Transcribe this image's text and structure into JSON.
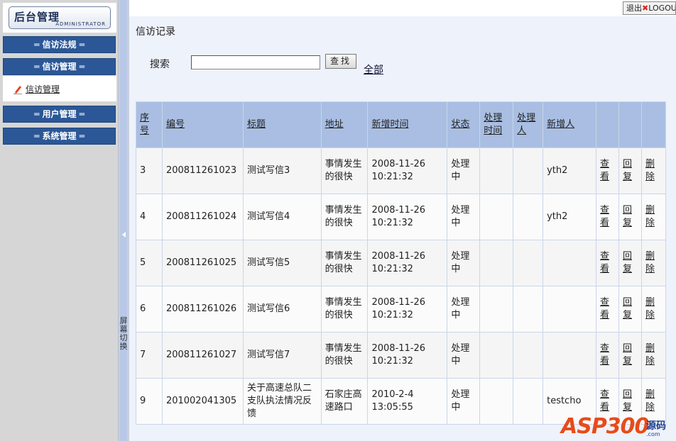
{
  "logo": {
    "title": "后台管理",
    "subtitle": "ADMINISTRATOR"
  },
  "nav": {
    "bars": "═",
    "groups": [
      "信访法规",
      "信访管理",
      "用户管理",
      "系统管理"
    ],
    "sub_item": "信访管理"
  },
  "splitter": {
    "label": "屏幕切换"
  },
  "topbar": {
    "logout_cn": "退出",
    "logout_en": "LOGOUT"
  },
  "page": {
    "title": "信访记录",
    "search_label": "搜索",
    "search_value": "",
    "search_button": "查找",
    "all_link": "全部"
  },
  "table": {
    "headers": [
      "序号",
      "编号",
      "标题",
      "地址",
      "新增时间",
      "状态",
      "处理时间",
      "处理人",
      "新增人",
      "",
      "",
      ""
    ],
    "actions": {
      "view": "查看",
      "reply": "回复",
      "delete": "删除"
    },
    "rows": [
      {
        "seq": "3",
        "code": "200811261023",
        "title": "测试写信3",
        "address": "事情发生的很快",
        "time": "2008-11-26 10:21:32",
        "status": "处理中",
        "handle_time": "",
        "handler": "",
        "creator": "yth2"
      },
      {
        "seq": "4",
        "code": "200811261024",
        "title": "测试写信4",
        "address": "事情发生的很快",
        "time": "2008-11-26 10:21:32",
        "status": "处理中",
        "handle_time": "",
        "handler": "",
        "creator": "yth2"
      },
      {
        "seq": "5",
        "code": "200811261025",
        "title": "测试写信5",
        "address": "事情发生的很快",
        "time": "2008-11-26 10:21:32",
        "status": "处理中",
        "handle_time": "",
        "handler": "",
        "creator": ""
      },
      {
        "seq": "6",
        "code": "200811261026",
        "title": "测试写信6",
        "address": "事情发生的很快",
        "time": "2008-11-26 10:21:32",
        "status": "处理中",
        "handle_time": "",
        "handler": "",
        "creator": ""
      },
      {
        "seq": "7",
        "code": "200811261027",
        "title": "测试写信7",
        "address": "事情发生的很快",
        "time": "2008-11-26 10:21:32",
        "status": "处理中",
        "handle_time": "",
        "handler": "",
        "creator": ""
      },
      {
        "seq": "9",
        "code": "201002041305",
        "title": "关于高速总队二支队执法情况反馈",
        "address": "石家庄高速路口",
        "time": "2010-2-4 13:05:55",
        "status": "处理中",
        "handle_time": "",
        "handler": "",
        "creator": "testcho"
      }
    ]
  },
  "watermark": {
    "brand": "ASP300",
    "suffix": "源码",
    "domain": ".com"
  },
  "colors": {
    "nav": "#2b5797",
    "table_header": "#a9bee2",
    "splitter": "#b9c8e6"
  }
}
